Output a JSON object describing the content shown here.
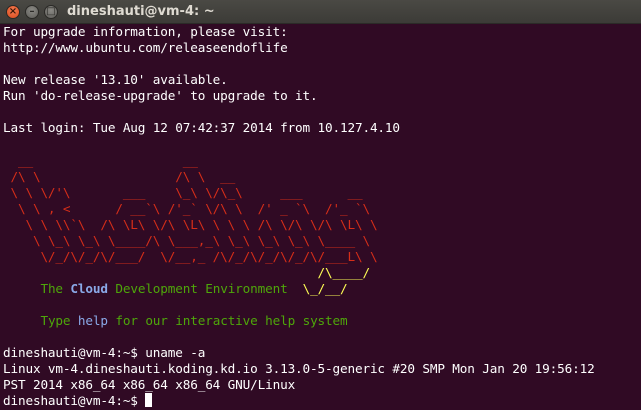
{
  "window": {
    "title": "dineshauti@vm-4: ~",
    "close_glyph": "×",
    "minimize_glyph": "–",
    "maximize_glyph": "□"
  },
  "terminal": {
    "upgrade_info": "For upgrade information, please visit:",
    "upgrade_url": "http://www.ubuntu.com/releaseendoflife",
    "new_release": "New release '13.10' available.",
    "upgrade_hint": "Run 'do-release-upgrade' to upgrade to it.",
    "last_login": "Last login: Tue Aug 12 07:42:37 2014 from 10.127.4.10",
    "logo_lines": [
      "  __                    __",
      " /\\ \\                  /\\ \\  __",
      " \\ \\ \\/'\\       ___    \\_\\ \\/\\_\\     ___      __",
      "  \\ \\ , <      / __`\\ /'_` \\/\\ \\  /' _ `\\  /'_ `\\",
      "   \\ \\ \\\\`\\  /\\ \\L\\ \\/\\ \\L\\ \\ \\ \\ /\\ \\/\\ \\/\\ \\L\\ \\",
      "    \\ \\_\\ \\_\\ \\____/\\ \\___,_\\ \\_\\ \\_\\ \\_\\ \\____ \\",
      "     \\/_/\\/_/\\/___/  \\/__,_ /\\/_/\\/_/\\/_/\\/___L\\ \\"
    ],
    "logo_tail_1": "                                          /\\____/",
    "logo_tail_2": "\\_/__/",
    "tagline_the": "The ",
    "tagline_cloud": "Cloud",
    "tagline_rest": " Development Environment",
    "type_word": "Type ",
    "help_word": "help",
    "help_rest": " for our interactive help system",
    "prompt": "dineshauti@vm-4:~$",
    "command": " uname -a",
    "output_1": "Linux vm-4.dineshauti.koding.kd.io 3.13.0-5-generic #20 SMP Mon Jan 20 19:56:12",
    "output_2": "PST 2014 x86_64 x86_64 x86_64 GNU/Linux",
    "prompt_2": "dineshauti@vm-4:~$ "
  },
  "colors": {
    "background": "#300a24",
    "logo_red": "#d62e19",
    "logo_yellow": "#ffff55",
    "tagline_green": "#4ea60a",
    "cloud_blue": "#8aa9e8"
  }
}
